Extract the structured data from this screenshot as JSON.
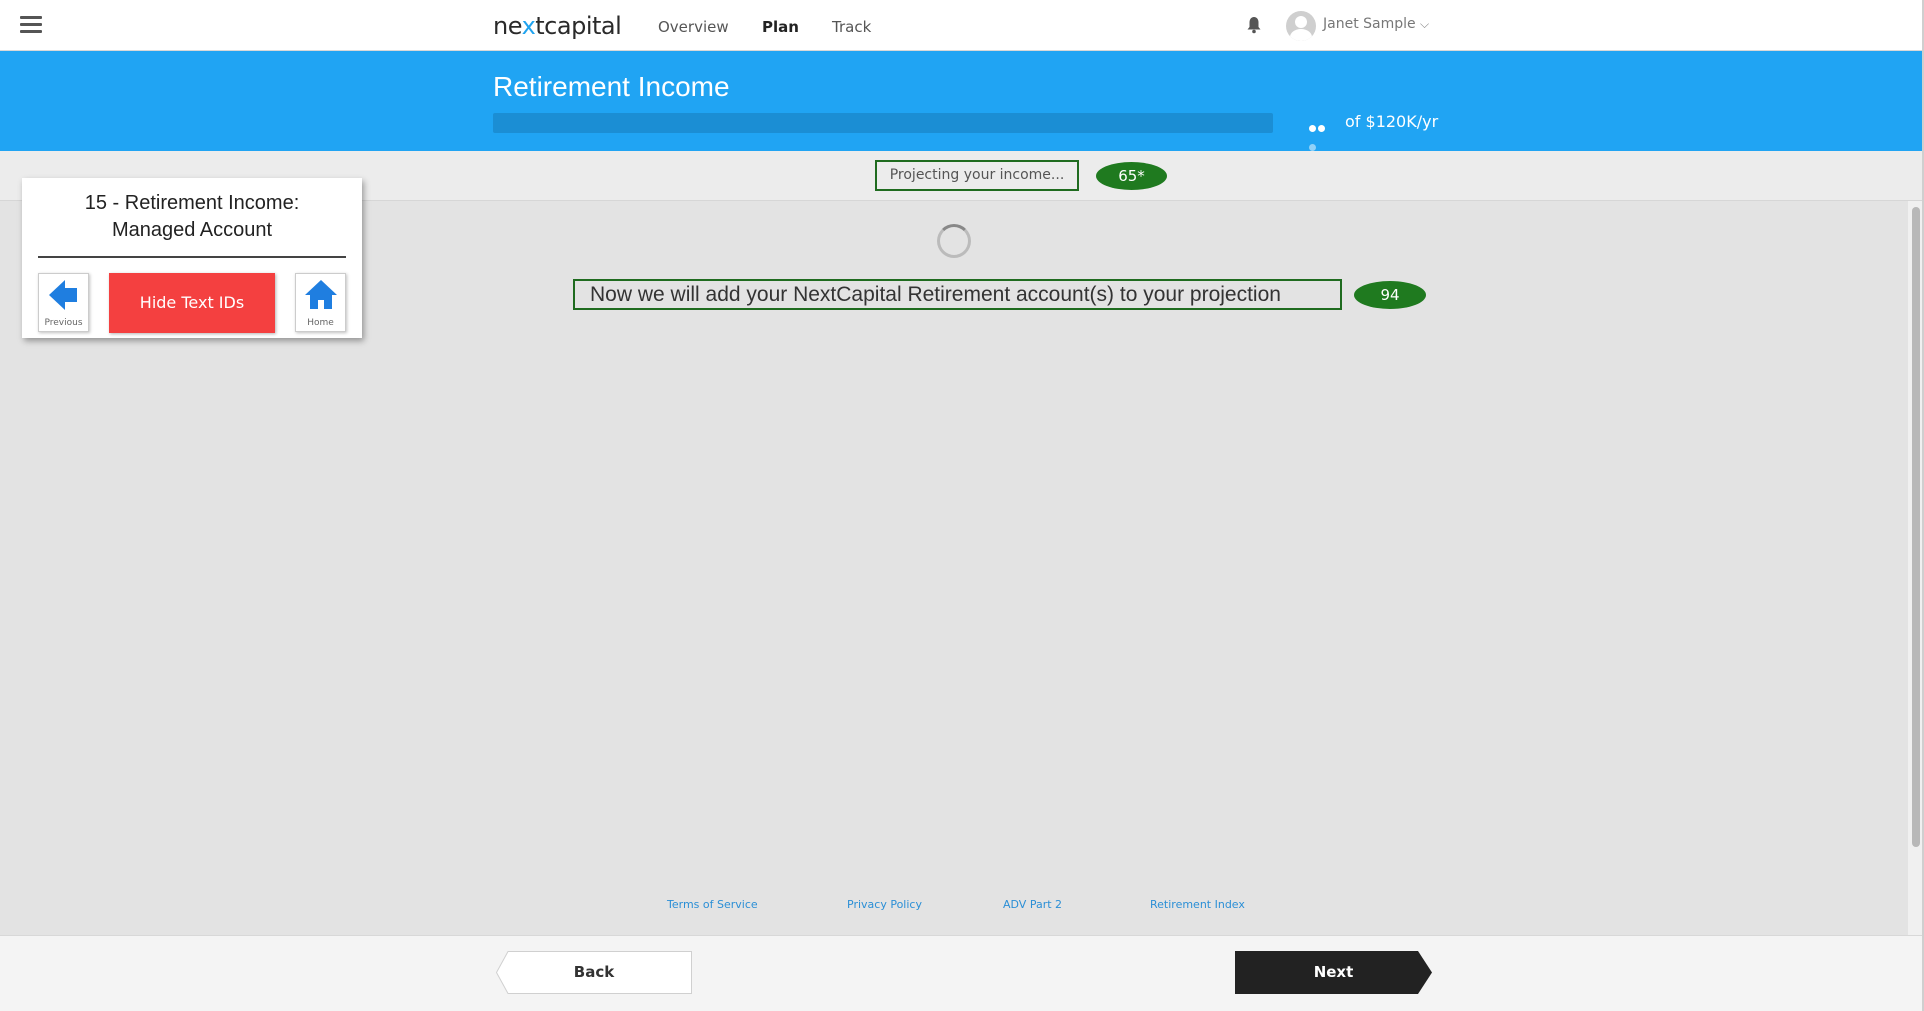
{
  "navbar": {
    "logo_prefix": "ne",
    "logo_x": "x",
    "logo_suffix": "tcapital",
    "links": [
      "Overview",
      "Plan",
      "Track"
    ],
    "active_link": "Plan",
    "user_name": "Janet Sample"
  },
  "hero": {
    "title": "Retirement Income",
    "goal_text": "of $120K/yr",
    "progress_fraction": 0
  },
  "status": {
    "projecting_text": "Projecting your income...",
    "projecting_badge": "65*"
  },
  "main": {
    "message": "Now we will add your NextCapital Retirement account(s) to your projection",
    "message_badge": "94"
  },
  "card": {
    "title_line1": "15 - Retirement Income:",
    "title_line2": "Managed Account",
    "previous_label": "Previous",
    "hide_label": "Hide Text IDs",
    "home_label": "Home"
  },
  "footer": {
    "links": [
      "Terms of Service",
      "Privacy Policy",
      "ADV Part 2",
      "Retirement Index"
    ]
  },
  "actions": {
    "back_label": "Back",
    "next_label": "Next"
  },
  "colors": {
    "brand_blue": "#20a4f3",
    "badge_green": "#1f7a1f",
    "hide_red": "#f44040",
    "next_dark": "#222222"
  }
}
